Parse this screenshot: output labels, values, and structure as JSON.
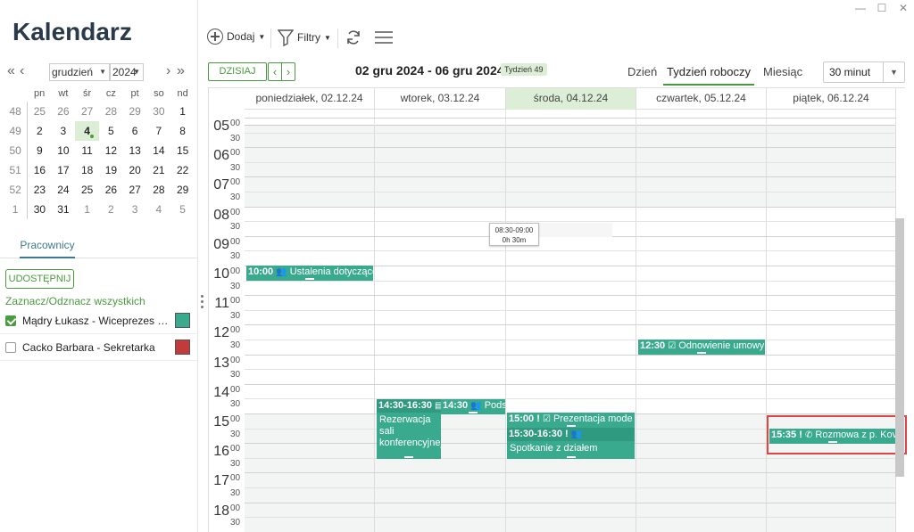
{
  "window": {
    "minimize": "—",
    "maximize": "☐",
    "close": "✕"
  },
  "sidebar": {
    "title": "Kalendarz",
    "month": "grudzień",
    "year": "2024",
    "nav": {
      "prev_year": "«",
      "prev_month": "‹",
      "next_month": "›",
      "next_year": "»"
    },
    "weekday_headers": [
      "pn",
      "wt",
      "śr",
      "cz",
      "pt",
      "so",
      "nd"
    ],
    "weeks": [
      {
        "num": "48",
        "days": [
          "25",
          "26",
          "27",
          "28",
          "29",
          "30",
          "1"
        ]
      },
      {
        "num": "49",
        "days": [
          "2",
          "3",
          "4",
          "5",
          "6",
          "7",
          "8"
        ]
      },
      {
        "num": "50",
        "days": [
          "9",
          "10",
          "11",
          "12",
          "13",
          "14",
          "15"
        ]
      },
      {
        "num": "51",
        "days": [
          "16",
          "17",
          "18",
          "19",
          "20",
          "21",
          "22"
        ]
      },
      {
        "num": "52",
        "days": [
          "23",
          "24",
          "25",
          "26",
          "27",
          "28",
          "29"
        ]
      },
      {
        "num": "1",
        "days": [
          "30",
          "31",
          "1",
          "2",
          "3",
          "4",
          "5"
        ]
      }
    ],
    "tab": "Pracownicy",
    "share_label": "UDOSTĘPNIJ",
    "toggle_all": "Zaznacz/Odznacz wszystkich",
    "employees": [
      {
        "name": "Mądry Łukasz - Wiceprezes zarządu",
        "checked": true,
        "color": "#3aaa8f"
      },
      {
        "name": "Cacko Barbara - Sekretarka",
        "checked": false,
        "color": "#c33a3a"
      }
    ]
  },
  "toolbar": {
    "add_label": "Dodaj",
    "filters_label": "Filtry"
  },
  "nav": {
    "today_label": "DZISIAJ",
    "prev": "‹",
    "next": "›",
    "range": "02 gru 2024 - 06 gru 2024",
    "week_badge": "Tydzień 49",
    "views": [
      "Dzień",
      "Tydzień roboczy",
      "Miesiąc"
    ],
    "interval": "30 minut"
  },
  "grid": {
    "days": [
      "poniedziałek, 02.12.24",
      "wtorek, 03.12.24",
      "środa, 04.12.24",
      "czwartek, 05.12.24",
      "piątek, 06.12.24"
    ],
    "hours": [
      "05",
      "06",
      "07",
      "08",
      "09",
      "10",
      "11",
      "12",
      "13",
      "14",
      "15",
      "16",
      "17",
      "18"
    ],
    "min00": "00",
    "min30": "30",
    "tooltip": {
      "range": "08:30-09:00",
      "duration": "0h 30m"
    }
  },
  "events": [
    {
      "time": "10:00",
      "title": "Ustalenia dotyczące",
      "icon": "people-icon"
    },
    {
      "time": "14:30-16:30",
      "title": "Rezerwacja sali konferencyjnej",
      "icon": "room-icon"
    },
    {
      "time": "14:30",
      "title": "Pods",
      "icon": "people-icon"
    },
    {
      "time": "15:00",
      "title": "Prezentacja mode",
      "icon": "task-icon",
      "priority": "!"
    },
    {
      "time": "15:30-16:30",
      "title": "Spotkanie z działem",
      "icon": "people-icon",
      "priority": "!"
    },
    {
      "time": "12:30",
      "title": "Odnowienie umowy",
      "icon": "task-icon"
    },
    {
      "time": "15:35",
      "title": "Rozmowa z p. Kov",
      "icon": "phone-icon",
      "priority": "!"
    }
  ]
}
